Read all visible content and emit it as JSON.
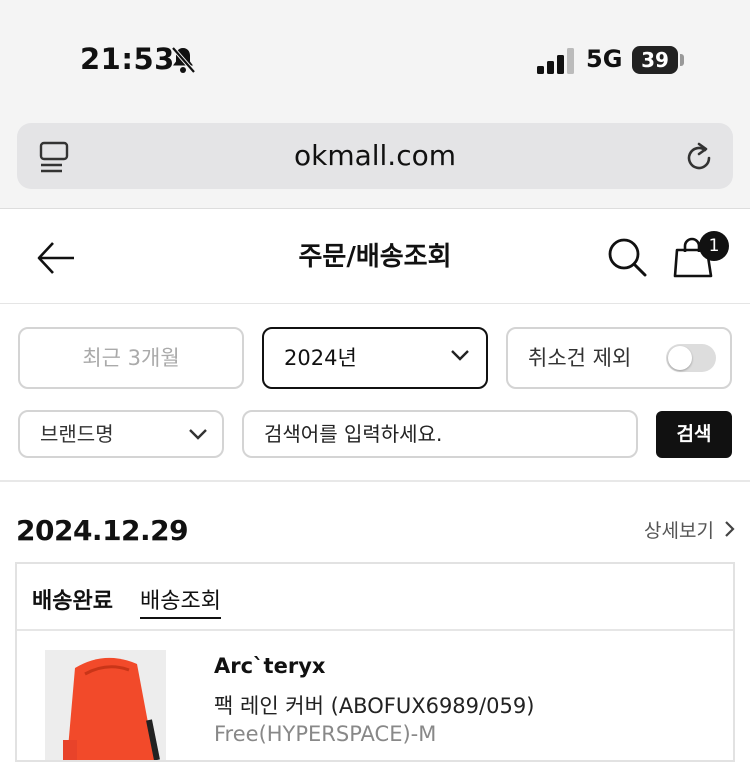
{
  "status_bar": {
    "time": "21:53",
    "network": "5G",
    "battery": "39",
    "icons": [
      "bell-mute-icon",
      "signal-icon",
      "battery-icon"
    ]
  },
  "browser": {
    "url": "okmall.com",
    "icons": [
      "reader-icon",
      "reload-icon"
    ]
  },
  "header": {
    "title": "주문/배송조회",
    "cart_count": "1",
    "icons": [
      "back-arrow-icon",
      "search-icon",
      "shopping-bag-icon"
    ]
  },
  "filters": {
    "period_button": "최근 3개월",
    "year_select": "2024년",
    "exclude_cancelled_label": "취소건 제외",
    "exclude_cancelled_on": false,
    "brand_select": "브랜드명",
    "search_placeholder": "검색어를 입력하세요.",
    "search_button": "검색"
  },
  "order": {
    "date": "2024.12.29",
    "detail_link": "상세보기",
    "status": "배송완료",
    "tracking_link": "배송조회",
    "item": {
      "brand": "Arc`teryx",
      "name": "팩 레인 커버 (ABOFUX6989/059)",
      "option": "Free(HYPERSPACE)-M"
    }
  },
  "colors": {
    "accent": "#111111",
    "product_image": "#f24a2a"
  }
}
